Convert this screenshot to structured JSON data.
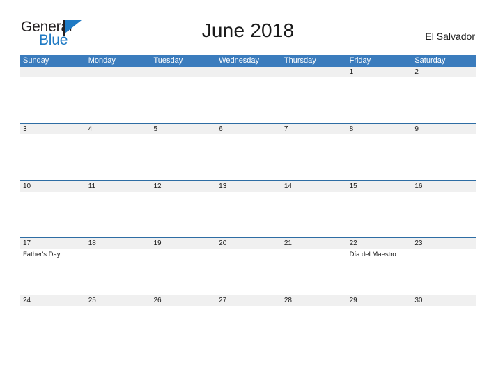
{
  "brand": {
    "name_part1": "General",
    "name_part2": "Blue",
    "flag_icon": "flag-triangle-icon",
    "accent_color": "#1f7ac4"
  },
  "header": {
    "title": "June 2018",
    "country": "El Salvador"
  },
  "colors": {
    "header_bar": "#3b7cbd",
    "divider": "#2e6da4",
    "date_strip": "#f0f0f0",
    "text": "#1a1a1a"
  },
  "weekdays": [
    "Sunday",
    "Monday",
    "Tuesday",
    "Wednesday",
    "Thursday",
    "Friday",
    "Saturday"
  ],
  "weeks": [
    {
      "dates": [
        "",
        "",
        "",
        "",
        "",
        "1",
        "2"
      ],
      "events": [
        "",
        "",
        "",
        "",
        "",
        "",
        ""
      ]
    },
    {
      "dates": [
        "3",
        "4",
        "5",
        "6",
        "7",
        "8",
        "9"
      ],
      "events": [
        "",
        "",
        "",
        "",
        "",
        "",
        ""
      ]
    },
    {
      "dates": [
        "10",
        "11",
        "12",
        "13",
        "14",
        "15",
        "16"
      ],
      "events": [
        "",
        "",
        "",
        "",
        "",
        "",
        ""
      ]
    },
    {
      "dates": [
        "17",
        "18",
        "19",
        "20",
        "21",
        "22",
        "23"
      ],
      "events": [
        "Father's Day",
        "",
        "",
        "",
        "",
        "Día del Maestro",
        ""
      ]
    },
    {
      "dates": [
        "24",
        "25",
        "26",
        "27",
        "28",
        "29",
        "30"
      ],
      "events": [
        "",
        "",
        "",
        "",
        "",
        "",
        ""
      ]
    }
  ]
}
